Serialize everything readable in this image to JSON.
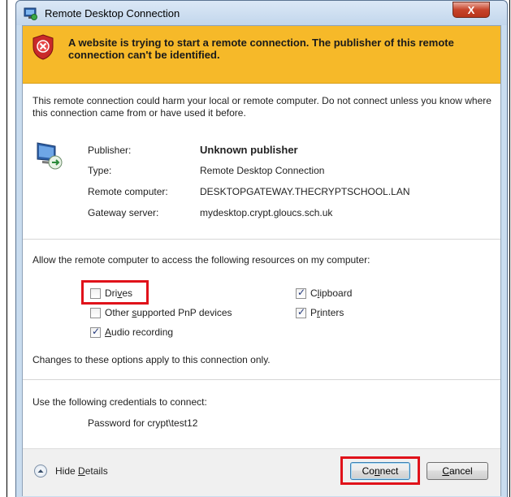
{
  "window": {
    "title": "Remote Desktop Connection",
    "close_label": "X"
  },
  "banner": {
    "message": "A website is trying to start a remote connection. The publisher of this remote connection can't be identified."
  },
  "warning": {
    "text": "This remote connection could harm your local or remote computer. Do not connect unless you know where this connection came from or have used it before."
  },
  "details": {
    "publisher_label": "Publisher:",
    "publisher_value": "Unknown publisher",
    "type_label": "Type:",
    "type_value": "Remote Desktop Connection",
    "remote_label": "Remote computer:",
    "remote_value": "DESKTOPGATEWAY.THECRYPTSCHOOL.LAN",
    "gateway_label": "Gateway server:",
    "gateway_value": "mydesktop.crypt.gloucs.sch.uk"
  },
  "resources": {
    "intro": "Allow the remote computer to access the following resources on my computer:",
    "drives": {
      "label_pre": "Dri",
      "label_u": "v",
      "label_post": "es",
      "checked": false
    },
    "pnp": {
      "label_pre": "Other ",
      "label_u": "s",
      "label_post": "upported PnP devices",
      "checked": false
    },
    "audio": {
      "label_pre": "",
      "label_u": "A",
      "label_post": "udio recording",
      "checked": true
    },
    "clipboard": {
      "label_pre": "C",
      "label_u": "l",
      "label_post": "ipboard",
      "checked": true
    },
    "printers": {
      "label_pre": "P",
      "label_u": "r",
      "label_post": "inters",
      "checked": true
    },
    "note": "Changes to these options apply to this connection only."
  },
  "credentials": {
    "intro": "Use the following credentials to connect:",
    "value": "Password for crypt\\test12"
  },
  "footer": {
    "hide_pre": "Hide ",
    "hide_u": "D",
    "hide_post": "etails",
    "connect_pre": "Co",
    "connect_u": "n",
    "connect_post": "nect",
    "cancel_pre": "",
    "cancel_u": "C",
    "cancel_post": "ancel"
  },
  "colors": {
    "banner": "#f6b929",
    "highlight": "#e0121a",
    "title_bar": "#c9dcef"
  },
  "icons": {
    "app": "remote-desktop-icon",
    "shield": "security-warning-shield-icon",
    "monitor": "remote-monitor-icon",
    "hide": "chevron-up-icon"
  }
}
